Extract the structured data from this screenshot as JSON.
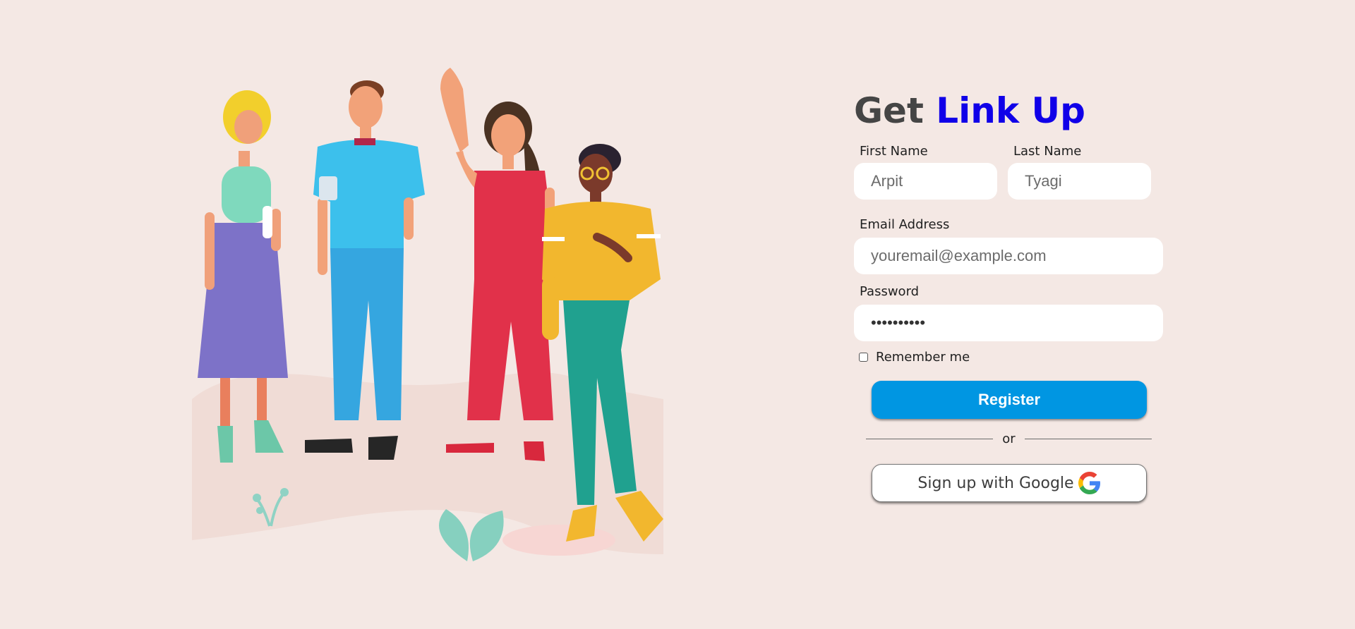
{
  "title": {
    "prefix": "Get",
    "accent": "Link Up"
  },
  "form": {
    "first_name": {
      "label": "First Name",
      "placeholder": "Arpit"
    },
    "last_name": {
      "label": "Last Name",
      "placeholder": "Tyagi"
    },
    "email": {
      "label": "Email Address",
      "placeholder": "youremail@example.com"
    },
    "password": {
      "label": "Password",
      "value": "••••••••••"
    },
    "remember": {
      "label": "Remember me",
      "checked": false
    },
    "register_label": "Register",
    "divider_text": "or",
    "google_label": "Sign up with Google"
  },
  "icons": {
    "google": "google-g-icon"
  },
  "colors": {
    "background": "#f4e8e4",
    "accent": "#1000e8",
    "title": "#454545",
    "register_button": "#0096e2"
  }
}
